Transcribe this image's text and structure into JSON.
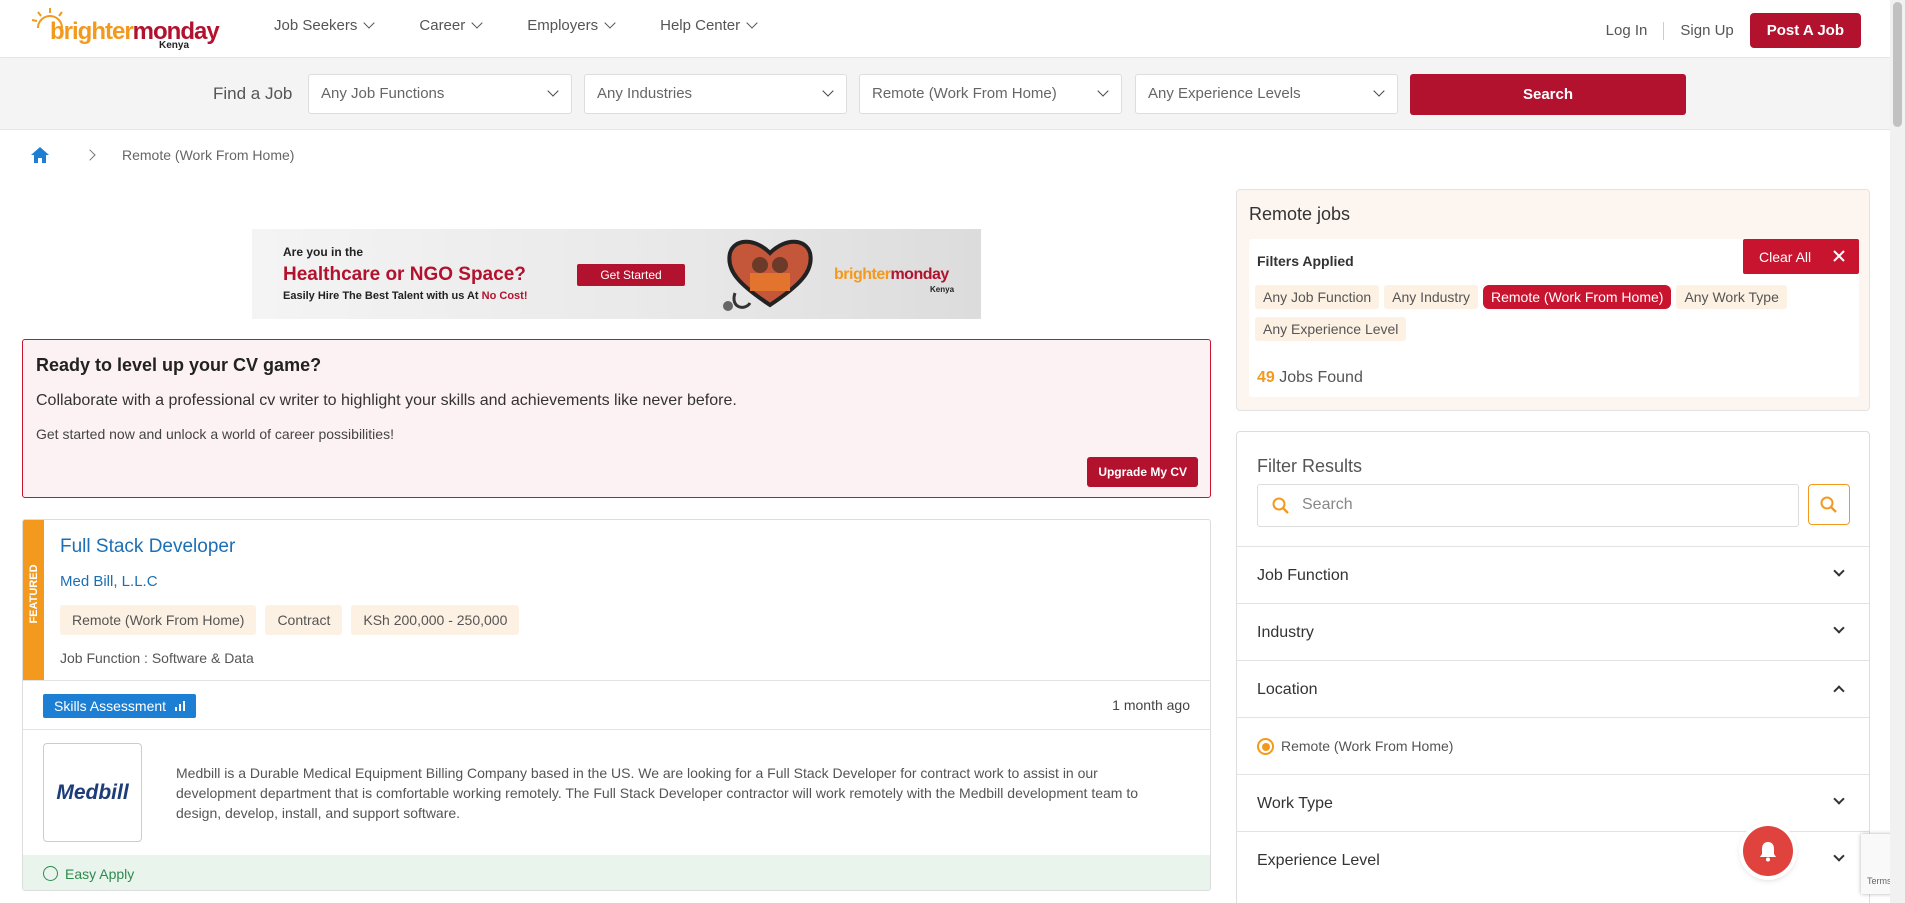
{
  "header": {
    "logo_text_1": "brighter",
    "logo_text_2": "monday",
    "logo_country": "Kenya",
    "nav": [
      "Job Seekers",
      "Career",
      "Employers",
      "Help Center"
    ],
    "login": "Log In",
    "signup": "Sign Up",
    "post_job": "Post A Job"
  },
  "search": {
    "label": "Find a Job",
    "job_functions": "Any Job Functions",
    "industries": "Any Industries",
    "location": "Remote (Work From Home)",
    "experience": "Any Experience Levels",
    "button": "Search"
  },
  "breadcrumb": {
    "current": "Remote (Work From Home)"
  },
  "banner": {
    "line1": "Are you in the",
    "line2": "Healthcare or NGO Space?",
    "line3": "Easily Hire The Best Talent with us At ",
    "line3_emph": "No Cost!",
    "cta": "Get Started",
    "logo_text_1": "brighter",
    "logo_text_2": "monday",
    "logo_country": "Kenya"
  },
  "cv_promo": {
    "title": "Ready to level up your CV game?",
    "subtitle": "Collaborate with a professional cv writer to highlight your skills and achievements like never before.",
    "text": "Get started now and unlock a world of career possibilities!",
    "button": "Upgrade My CV"
  },
  "job": {
    "featured_label": "FEATURED",
    "title": "Full Stack Developer",
    "company": "Med Bill, L.L.C",
    "tags": [
      "Remote (Work From Home)",
      "Contract",
      "KSh 200,000 - 250,000"
    ],
    "job_function": "Job Function : Software & Data",
    "skills_badge": "Skills Assessment",
    "posted": "1 month ago",
    "company_logo": "Medbill",
    "description": "Medbill is a Durable Medical Equipment Billing Company based in the US. We are looking for a Full Stack Developer for contract work to assist in our development department that is comfortable working remotely. The Full Stack Developer contractor will work remotely with the Medbill development team to design, develop, install, and support software.",
    "easy_apply": "Easy Apply"
  },
  "filters_applied": {
    "title": "Remote jobs",
    "label": "Filters Applied",
    "clear_all": "Clear All",
    "chips": [
      "Any Job Function",
      "Any Industry",
      "Remote (Work From Home)",
      "Any Work Type",
      "Any Experience Level"
    ],
    "active_chip": "Remote (Work From Home)",
    "count": "49",
    "count_suffix": " Jobs Found"
  },
  "filter_results": {
    "title": "Filter Results",
    "search_placeholder": "Search",
    "sections": [
      "Job Function",
      "Industry",
      "Location",
      "Work Type",
      "Experience Level"
    ],
    "location_option": "Remote (Work From Home)"
  },
  "recaptcha_text": "Terms",
  "colors": {
    "brand_red": "#b3122e",
    "brand_orange": "#f39a1e",
    "link_blue": "#1c6fb5"
  }
}
